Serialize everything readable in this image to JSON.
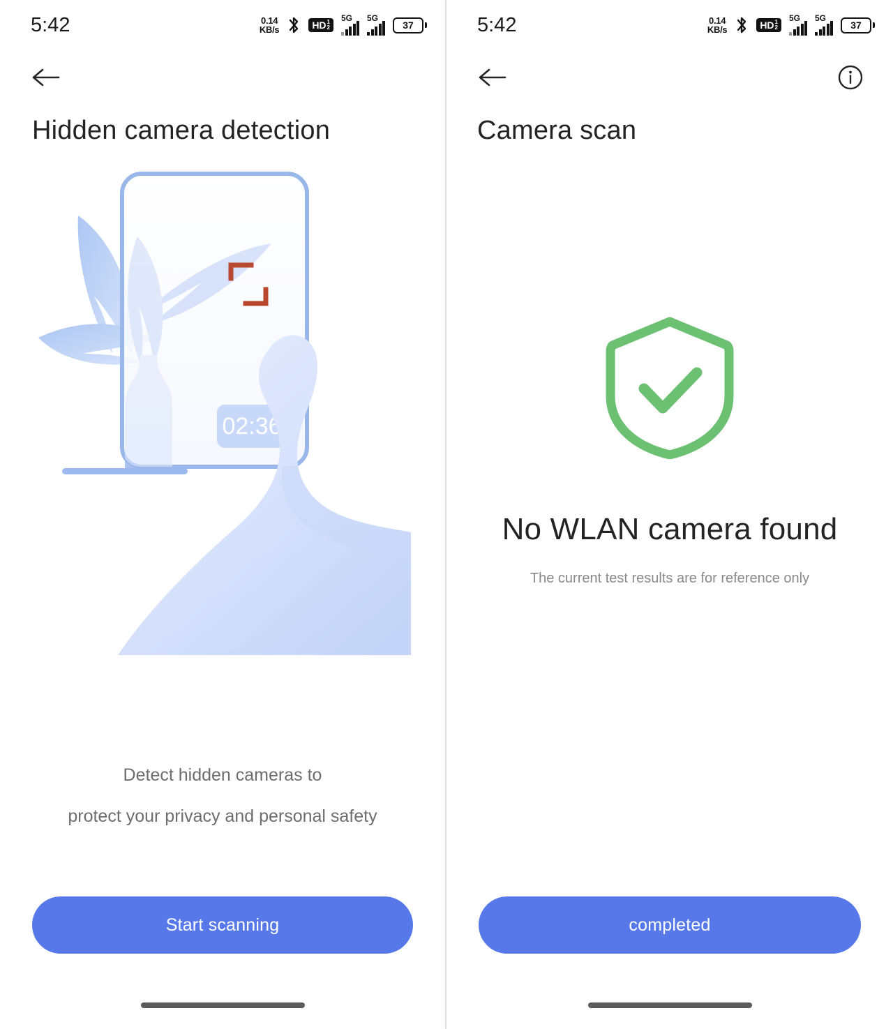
{
  "status_bar": {
    "time": "5:42",
    "net_speed_value": "0.14",
    "net_speed_unit": "KB/s",
    "bluetooth_icon": "bluetooth-icon",
    "hd_label": "HD",
    "hd_sub_top": "1",
    "hd_sub_bottom": "2",
    "signal_1_gen": "5G",
    "signal_2_gen": "5G",
    "battery_level": "37"
  },
  "left_screen": {
    "back_icon": "back-arrow-icon",
    "title": "Hidden camera detection",
    "illustration": {
      "timer_badge": "02:36",
      "focus_bracket_color": "#b8482f",
      "phone_outline_color": "#9ab7ea",
      "leaf_color": "#b8cdf3",
      "hand_color": "#dbe4fb"
    },
    "caption_line1": "Detect hidden cameras to",
    "caption_line2": "protect your privacy and personal safety",
    "cta_label": "Start scanning",
    "cta_color": "#5778e8"
  },
  "right_screen": {
    "back_icon": "back-arrow-icon",
    "info_icon": "info-circle-icon",
    "title": "Camera scan",
    "shield_icon": "shield-check-icon",
    "shield_color": "#6cc072",
    "result_title": "No WLAN camera found",
    "result_subtitle": "The current test results are for reference only",
    "cta_label": "completed",
    "cta_color": "#5778e8"
  }
}
